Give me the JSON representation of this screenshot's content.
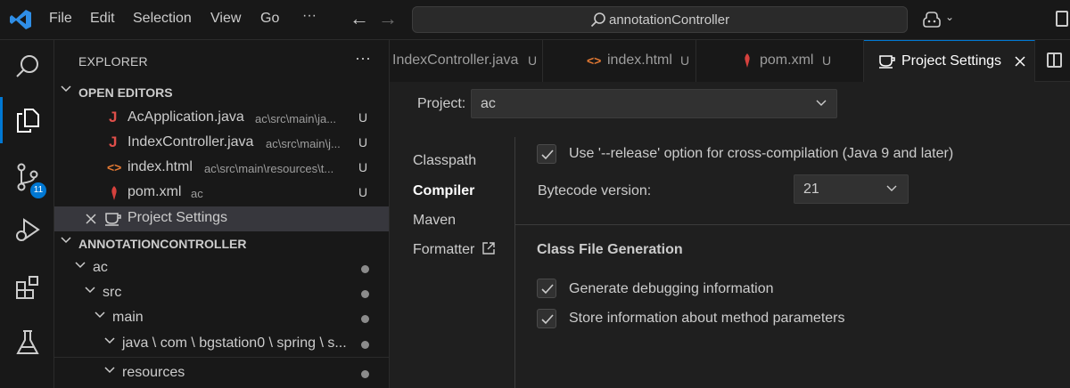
{
  "titlebar": {
    "menus": [
      "File",
      "Edit",
      "Selection",
      "View",
      "Go"
    ],
    "more": "···",
    "back_arrow": "←",
    "forward_arrow": "→",
    "search_text": "annotationController",
    "chevron": "⌄"
  },
  "activitybar": {
    "items": [
      "search-icon",
      "explorer-icon",
      "source-control-icon",
      "run-debug-icon",
      "extensions-icon",
      "testing-icon"
    ],
    "source_control_badge": "11"
  },
  "sidebar": {
    "header": "EXPLORER",
    "more": "···",
    "open_editors_title": "OPEN EDITORS",
    "open_editors": [
      {
        "icon": "J",
        "name": "AcApplication.java",
        "path": "ac\\src\\main\\ja...",
        "status": "U"
      },
      {
        "icon": "J",
        "name": "IndexController.java",
        "path": "ac\\src\\main\\j...",
        "status": "U"
      },
      {
        "icon": "<>",
        "name": "index.html",
        "path": "ac\\src\\main\\resources\\t...",
        "status": "U"
      },
      {
        "icon": "maven-icon",
        "name": "pom.xml",
        "path": "ac",
        "status": "U"
      },
      {
        "icon": "coffee-icon",
        "name": "Project Settings",
        "path": "",
        "status": ""
      }
    ],
    "project_title": "ANNOTATIONCONTROLLER",
    "tree": [
      {
        "name": "ac"
      },
      {
        "name": "src"
      },
      {
        "name": "main"
      },
      {
        "name": "java \\ com \\ bgstation0 \\ spring \\ s..."
      },
      {
        "name": "resources"
      }
    ]
  },
  "tabs": [
    {
      "label": "IndexController.java",
      "status": "U",
      "icon": ""
    },
    {
      "label": "index.html",
      "status": "U",
      "icon": "<>"
    },
    {
      "label": "pom.xml",
      "status": "U",
      "icon": "maven-icon"
    },
    {
      "label": "Project Settings",
      "status": "",
      "icon": "coffee-icon"
    }
  ],
  "settings": {
    "project_label": "Project:",
    "project_value": "ac",
    "nav": [
      "Classpath",
      "Compiler",
      "Maven",
      "Formatter"
    ],
    "active_nav": "Compiler",
    "release_option": "Use '--release' option for cross-compilation (Java 9 and later)",
    "release_checked": true,
    "bytecode_label": "Bytecode version:",
    "bytecode_value": "21",
    "section_title": "Class File Generation",
    "debug_info": "Generate debugging information",
    "debug_checked": true,
    "method_params": "Store information about method parameters",
    "method_params_checked": true
  },
  "colors": {
    "accent": "#0078d4",
    "java_icon": "#e04f4a",
    "html_icon": "#e37933",
    "maven_icon": "#d6413d"
  }
}
